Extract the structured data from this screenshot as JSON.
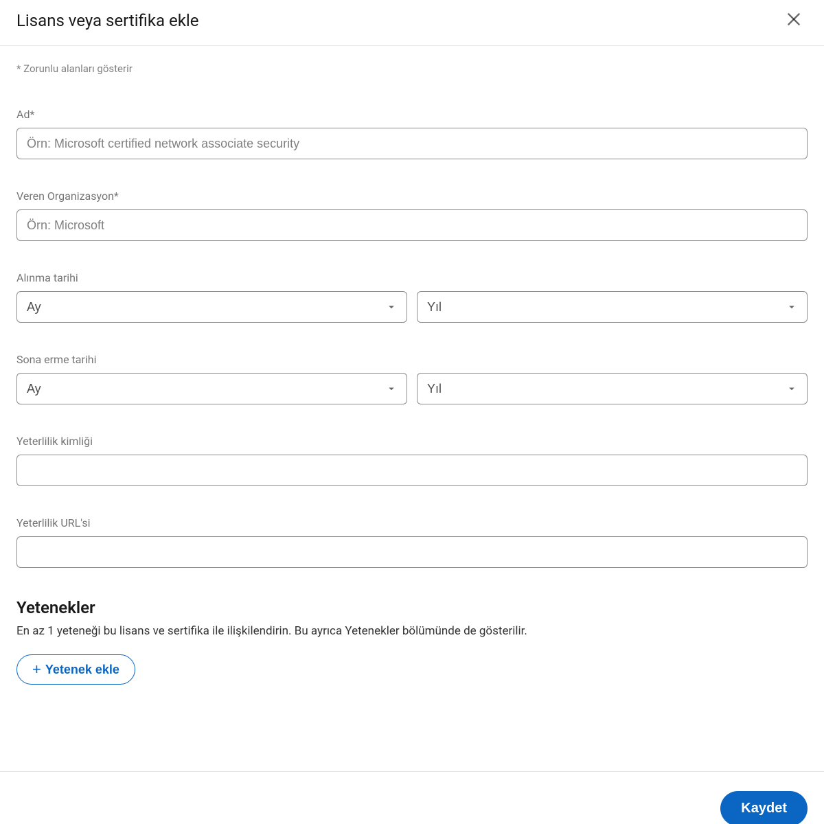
{
  "header": {
    "title": "Lisans veya sertifika ekle"
  },
  "requiredNote": "* Zorunlu alanları gösterir",
  "fields": {
    "name": {
      "label": "Ad*",
      "placeholder": "Örn: Microsoft certified network associate security"
    },
    "org": {
      "label": "Veren Organizasyon*",
      "placeholder": "Örn: Microsoft"
    },
    "issueDate": {
      "label": "Alınma tarihi",
      "month": "Ay",
      "year": "Yıl"
    },
    "expDate": {
      "label": "Sona erme tarihi",
      "month": "Ay",
      "year": "Yıl"
    },
    "credentialId": {
      "label": "Yeterlilik kimliği"
    },
    "credentialUrl": {
      "label": "Yeterlilik URL'si"
    }
  },
  "skills": {
    "heading": "Yetenekler",
    "description": "En az 1 yeteneği bu lisans ve sertifika ile ilişkilendirin. Bu ayrıca Yetenekler bölümünde de gösterilir.",
    "addLabel": "Yetenek ekle"
  },
  "footer": {
    "save": "Kaydet"
  }
}
